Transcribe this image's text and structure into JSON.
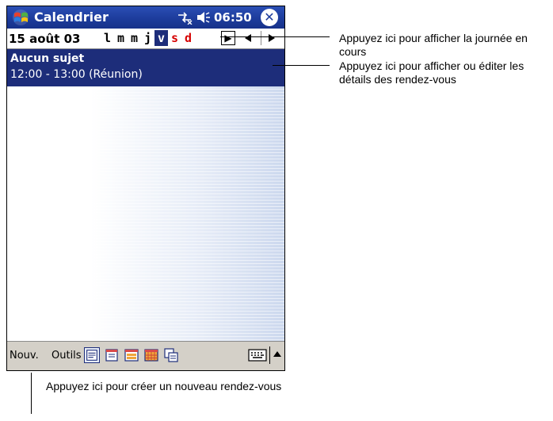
{
  "titlebar": {
    "app_title": "Calendrier",
    "clock": "06:50",
    "close_glyph": "✕",
    "icons": [
      "start-flag-icon",
      "connectivity-icon",
      "volume-icon",
      "close-icon"
    ]
  },
  "daybar": {
    "date": "15 août 03",
    "weekdays": [
      "l",
      "m",
      "m",
      "j",
      "v",
      "s",
      "d"
    ],
    "selected_index": 4,
    "today_glyph": "▶"
  },
  "appointment": {
    "subject": "Aucun sujet",
    "time": "12:00 - 13:00 (Réunion)"
  },
  "menubar": {
    "new_label": "Nouv.",
    "tools_label": "Outils",
    "views": [
      "agenda-view-icon",
      "day-view-icon",
      "week-view-icon",
      "month-view-icon",
      "year-view-icon"
    ]
  },
  "callouts": {
    "today": "Appuyez ici pour afficher la journée en cours",
    "details": "Appuyez ici pour afficher ou éditer les détails des rendez-vous",
    "new": "Appuyez ici pour créer un nouveau rendez-vous"
  },
  "colors": {
    "title_blue": "#1d3c9c",
    "selection_blue": "#1d2d7a",
    "weekend_red": "#d60000",
    "menubar_gray": "#d4d0c8"
  }
}
